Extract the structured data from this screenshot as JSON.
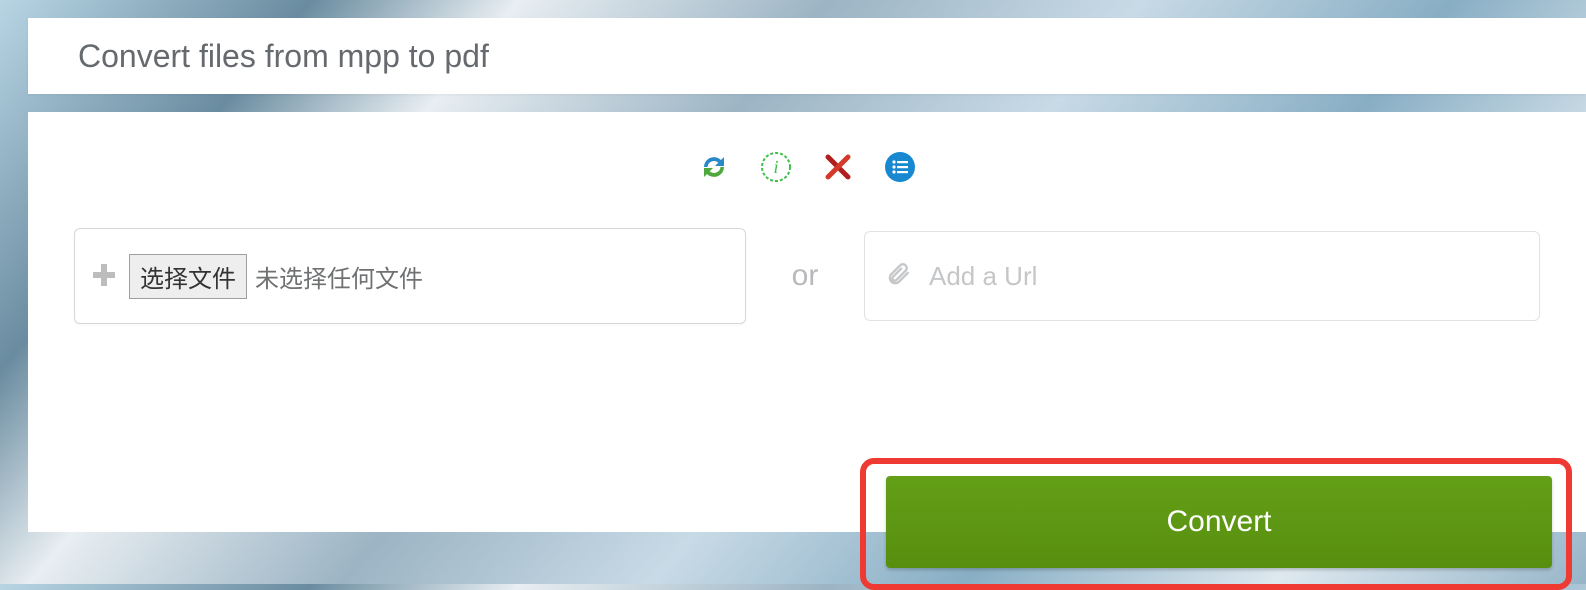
{
  "header": {
    "title": "Convert files from mpp to pdf"
  },
  "toolbar": {
    "refresh_name": "refresh-icon",
    "info_name": "info-icon",
    "delete_name": "delete-icon",
    "list_name": "list-icon"
  },
  "file": {
    "choose_label": "选择文件",
    "no_file_label": "未选择任何文件"
  },
  "separator": {
    "or": "or"
  },
  "url": {
    "placeholder": "Add a Url"
  },
  "actions": {
    "convert": "Convert"
  }
}
